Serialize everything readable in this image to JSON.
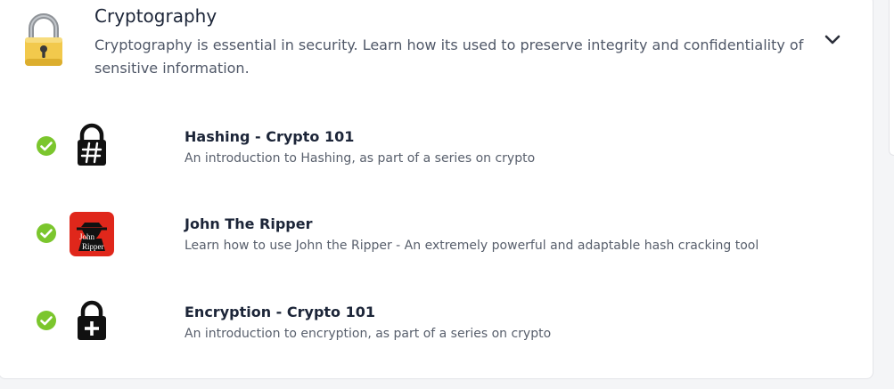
{
  "module": {
    "title": "Cryptography",
    "description": "Cryptography is essential in security. Learn how its used to preserve integrity and confidentiality of sensitive information.",
    "icon": "padlock-icon",
    "expand_icon": "chevron-down-icon"
  },
  "rooms": [
    {
      "title": "Hashing - Crypto 101",
      "description": "An introduction to Hashing, as part of a series on crypto",
      "icon": "hash-lock-icon",
      "completed": true
    },
    {
      "title": "John The Ripper",
      "description": "Learn how to use John the Ripper - An extremely powerful and adaptable hash cracking tool",
      "icon": "john-the-ripper-logo",
      "logo_text_1": "John",
      "logo_text_2": "Ripper",
      "completed": true
    },
    {
      "title": "Encryption - Crypto 101",
      "description": "An introduction to encryption, as part of a series on crypto",
      "icon": "lock-plus-icon",
      "completed": true
    }
  ],
  "colors": {
    "check_green": "#7bc62d",
    "logo_red": "#e0271b",
    "lock_gold": "#f2c94c"
  }
}
